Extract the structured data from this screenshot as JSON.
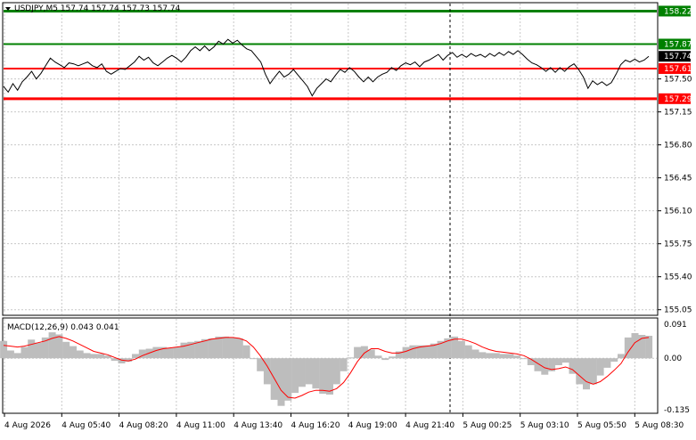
{
  "symbol_header": "USDJPY,M5  157.74 157.74 157.73 157.74",
  "macd_header": "MACD(12,26,9) 0.043 0.041",
  "colors": {
    "price": "#000000",
    "support": "#ff0000",
    "resistance": "#008000",
    "macd_hist": "#bdbdbd",
    "signal": "#ff0000",
    "grid": "#c8c8c8",
    "label_text": "#ffffff",
    "current_label_bg": "#000000"
  },
  "chart_data": [
    {
      "type": "line",
      "name": "price",
      "ylim": [
        155.0,
        158.3
      ],
      "y_ticks": [
        "157.50",
        "157.15",
        "156.80",
        "156.45",
        "156.10",
        "155.75",
        "155.40",
        "155.05"
      ],
      "x_ticks": [
        "4 Aug 2026",
        "4 Aug 05:40",
        "4 Aug 08:20",
        "4 Aug 11:00",
        "4 Aug 13:40",
        "4 Aug 16:20",
        "4 Aug 19:00",
        "4 Aug 21:40",
        "5 Aug 00:25",
        "5 Aug 03:10",
        "5 Aug 05:50",
        "5 Aug 08:30"
      ],
      "levels": [
        {
          "label": "158.22",
          "value": 158.22,
          "kind": "resistance"
        },
        {
          "label": "157.87",
          "value": 157.87,
          "kind": "resistance"
        },
        {
          "label": "157.61",
          "value": 157.61,
          "kind": "support"
        },
        {
          "label": "157.29",
          "value": 157.29,
          "kind": "support"
        }
      ],
      "current": {
        "label": "157.74",
        "value": 157.74
      },
      "series": [
        {
          "values": [
            157.42,
            157.36,
            157.45,
            157.38,
            157.47,
            157.52,
            157.58,
            157.5,
            157.56,
            157.64,
            157.72,
            157.68,
            157.65,
            157.62,
            157.67,
            157.66,
            157.64,
            157.66,
            157.68,
            157.64,
            157.62,
            157.66,
            157.58,
            157.55,
            157.58,
            157.61,
            157.6,
            157.64,
            157.68,
            157.74,
            157.7,
            157.73,
            157.67,
            157.64,
            157.68,
            157.72,
            157.75,
            157.72,
            157.68,
            157.73,
            157.8,
            157.84,
            157.8,
            157.85,
            157.8,
            157.84,
            157.9,
            157.87,
            157.92,
            157.88,
            157.91,
            157.86,
            157.82,
            157.8,
            157.74,
            157.68,
            157.55,
            157.45,
            157.52,
            157.58,
            157.52,
            157.55,
            157.6,
            157.54,
            157.48,
            157.42,
            157.32,
            157.4,
            157.45,
            157.5,
            157.47,
            157.54,
            157.6,
            157.57,
            157.62,
            157.58,
            157.52,
            157.47,
            157.52,
            157.47,
            157.52,
            157.55,
            157.57,
            157.62,
            157.59,
            157.64,
            157.67,
            157.65,
            157.68,
            157.63,
            157.68,
            157.7,
            157.73,
            157.76,
            157.7,
            157.75,
            157.78,
            157.73,
            157.76,
            157.73,
            157.77,
            157.74,
            157.76,
            157.73,
            157.77,
            157.74,
            157.78,
            157.75,
            157.79,
            157.76,
            157.8,
            157.76,
            157.71,
            157.67,
            157.65,
            157.62,
            157.58,
            157.62,
            157.57,
            157.62,
            157.58,
            157.63,
            157.66,
            157.6,
            157.52,
            157.4,
            157.48,
            157.44,
            157.47,
            157.43,
            157.46,
            157.55,
            157.65,
            157.7,
            157.68,
            157.71,
            157.68,
            157.7,
            157.74
          ]
        }
      ]
    },
    {
      "type": "bar",
      "name": "MACD(12,26,9)",
      "ylim": [
        -0.125,
        0.091
      ],
      "y_ticks": [
        "0.091",
        "0.00",
        "-0.135"
      ],
      "series": [
        {
          "name": "MACD",
          "values": [
            0.04,
            0.018,
            0.012,
            0.026,
            0.043,
            0.036,
            0.048,
            0.06,
            0.055,
            0.038,
            0.028,
            0.018,
            0.012,
            0.01,
            0.01,
            0.006,
            -0.006,
            -0.012,
            -0.008,
            0.01,
            0.02,
            0.022,
            0.026,
            0.026,
            0.024,
            0.026,
            0.036,
            0.038,
            0.04,
            0.044,
            0.046,
            0.05,
            0.05,
            0.048,
            0.046,
            0.03,
            -0.002,
            -0.03,
            -0.06,
            -0.096,
            -0.11,
            -0.098,
            -0.08,
            -0.066,
            -0.06,
            -0.07,
            -0.082,
            -0.084,
            -0.06,
            -0.03,
            0.002,
            0.026,
            0.028,
            0.02,
            0.006,
            -0.004,
            0.004,
            0.016,
            0.026,
            0.03,
            0.03,
            0.03,
            0.034,
            0.04,
            0.046,
            0.05,
            0.04,
            0.03,
            0.02,
            0.014,
            0.012,
            0.012,
            0.01,
            0.01,
            0.006,
            -0.002,
            -0.016,
            -0.03,
            -0.038,
            -0.03,
            -0.016,
            -0.01,
            -0.036,
            -0.06,
            -0.072,
            -0.06,
            -0.04,
            -0.022,
            -0.008,
            0.01,
            0.048,
            0.058,
            0.054,
            0.052
          ]
        },
        {
          "name": "Signal",
          "values": [
            0.03,
            0.028,
            0.026,
            0.028,
            0.032,
            0.036,
            0.04,
            0.046,
            0.05,
            0.046,
            0.04,
            0.032,
            0.024,
            0.016,
            0.012,
            0.008,
            0.002,
            -0.004,
            -0.006,
            -0.002,
            0.006,
            0.012,
            0.018,
            0.022,
            0.024,
            0.026,
            0.028,
            0.032,
            0.036,
            0.04,
            0.044,
            0.046,
            0.048,
            0.048,
            0.046,
            0.04,
            0.026,
            0.006,
            -0.018,
            -0.046,
            -0.074,
            -0.09,
            -0.092,
            -0.086,
            -0.078,
            -0.074,
            -0.074,
            -0.076,
            -0.07,
            -0.056,
            -0.034,
            -0.008,
            0.012,
            0.022,
            0.022,
            0.016,
            0.012,
            0.012,
            0.016,
            0.022,
            0.026,
            0.028,
            0.03,
            0.034,
            0.04,
            0.044,
            0.044,
            0.04,
            0.034,
            0.026,
            0.02,
            0.016,
            0.014,
            0.012,
            0.01,
            0.006,
            -0.002,
            -0.012,
            -0.022,
            -0.026,
            -0.024,
            -0.02,
            -0.026,
            -0.04,
            -0.054,
            -0.06,
            -0.054,
            -0.042,
            -0.028,
            -0.012,
            0.014,
            0.036,
            0.046,
            0.048
          ]
        }
      ]
    }
  ]
}
